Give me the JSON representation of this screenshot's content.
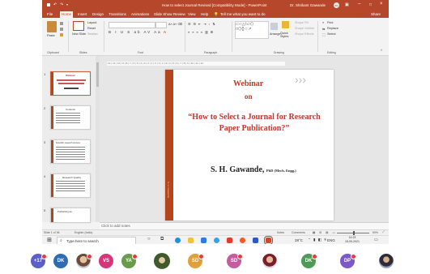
{
  "window": {
    "title": "How to select Journal Revised [Compatibility Mode] - PowerPoint",
    "user": "Dr. Shrikant Gawande",
    "user_initials": "SG",
    "share_label": "Share",
    "menu": [
      "File",
      "Home",
      "Insert",
      "Design",
      "Transitions",
      "Animations",
      "Slide Show",
      "Review",
      "View",
      "Help"
    ],
    "tell_me": "Tell me what you want to do"
  },
  "ribbon": {
    "groups": [
      "Clipboard",
      "Slides",
      "Font",
      "Paragraph",
      "Drawing",
      "Editing"
    ],
    "paste_label": "Paste",
    "new_slide_label": "New Slide",
    "layout_label": "Layout",
    "reset_label": "Reset",
    "section_label": "Section",
    "arrange_label": "Arrange",
    "quick_styles_label": "Quick Styles",
    "shape_fill_label": "Shape Fill",
    "shape_outline_label": "Shape Outline",
    "shape_effects_label": "Shape Effects",
    "find_label": "Find",
    "replace_label": "Replace",
    "select_label": "Select"
  },
  "ruler_text": "·12·|·11·|·10·|·9·|·8·|·7·|·6·|·5·|·4·|·3·|·2·|·1·|·0·|·1·|·2·|·3·|·4·|·5·|·6·|·7·|·8·|·9·|·10·|·11·|·12·",
  "thumbnails": [
    {
      "num": "1",
      "title": "Webinar",
      "active": true
    },
    {
      "num": "2",
      "title": "Contents",
      "active": false
    },
    {
      "num": "3",
      "title": "Scientific research process",
      "active": false
    },
    {
      "num": "4",
      "title": "Research Quality",
      "active": false
    },
    {
      "num": "5",
      "title": "Publishing as",
      "active": false
    }
  ],
  "slide": {
    "heading1": "Webinar",
    "heading2": "on",
    "title": "“How to Select a Journal for Research Paper Publication?”",
    "author": "S. H. Gawande,",
    "author_suffix": "PhD (Mech. Engg.)",
    "chevrons": "›››",
    "side_text": "S. H. Gawande"
  },
  "notes_placeholder": "Click to add notes",
  "status": {
    "slide_count": "Slide 1 of 36",
    "language": "English (India)",
    "notes_label": "Notes",
    "comments_label": "Comments",
    "zoom": "69%"
  },
  "taskbar": {
    "search_placeholder": "Type here to search",
    "weather": "28°C",
    "language": "ENG",
    "time": "14:23",
    "date": "15-09-2021"
  },
  "participants": [
    {
      "label": "+17",
      "color": "#5b5fc7",
      "type": "count"
    },
    {
      "label": "DK",
      "color": "#2f6db3",
      "type": "initials"
    },
    {
      "label": "",
      "color": "",
      "type": "photo"
    },
    {
      "label": "VS",
      "color": "#d6357a",
      "type": "initials"
    },
    {
      "label": "YA",
      "color": "#6a9a4c",
      "type": "initials"
    },
    {
      "label": "",
      "color": "",
      "type": "photo"
    },
    {
      "label": "SD",
      "color": "#e0a03c",
      "type": "initials"
    },
    {
      "label": "SD",
      "color": "#c65ca0",
      "type": "initials"
    },
    {
      "label": "",
      "color": "",
      "type": "photo"
    },
    {
      "label": "DK",
      "color": "#4f9a56",
      "type": "initials"
    },
    {
      "label": "DP",
      "color": "#7b59c9",
      "type": "initials"
    },
    {
      "label": "",
      "color": "",
      "type": "photo"
    }
  ],
  "colors": {
    "accent": "#b7472a",
    "slide_bar": "#b5461b",
    "slide_title": "#c0392b"
  }
}
